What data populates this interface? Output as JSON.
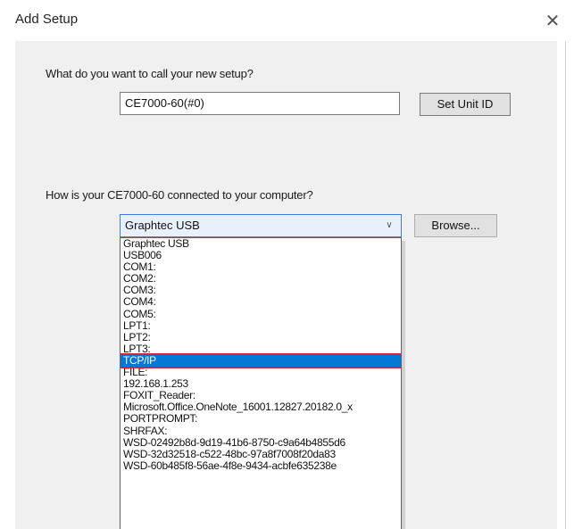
{
  "window": {
    "title": "Add Setup",
    "close_glyph": "✕"
  },
  "name_section": {
    "question": "What do you want to call your new setup?",
    "value": "CE7000-60(#0)",
    "set_unit_button": "Set Unit ID"
  },
  "connection_section": {
    "question": "How is your CE7000-60 connected to your computer?",
    "selected": "Graphtec USB",
    "browse_button": "Browse...",
    "options": [
      "Graphtec USB",
      "USB006",
      "COM1:",
      "COM2:",
      "COM3:",
      "COM4:",
      "COM5:",
      "LPT1:",
      "LPT2:",
      "LPT3:",
      "TCP/IP",
      "FILE:",
      "192.168.1.253",
      "FOXIT_Reader:",
      "Microsoft.Office.OneNote_16001.12827.20182.0_x",
      "PORTPROMPT:",
      "SHRFAX:",
      "WSD-02492b8d-9d19-41b6-8750-c9a64b4855d6",
      "WSD-32d32518-c522-48bc-97a8f7008f20da83",
      "WSD-60b485f8-56ae-4f8e-9434-acbfe635238e"
    ],
    "highlighted_option": "TCP/IP"
  },
  "colors": {
    "dialog_background": "#f0f0f0",
    "selection": "#0078d7",
    "highlight_box": "#d9242b"
  }
}
